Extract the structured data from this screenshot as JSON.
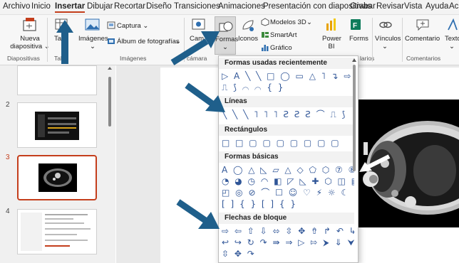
{
  "menu": {
    "tabs": [
      "Archivo",
      "Inicio",
      "Insertar",
      "Dibujar",
      "Recortar",
      "Diseño",
      "Transiciones",
      "Animaciones",
      "Presentación con diapositivas",
      "Grabar",
      "Revisar",
      "Vista",
      "Ayuda",
      "Ac"
    ],
    "active": "Insertar"
  },
  "ribbon": {
    "nueva_line1": "Nueva",
    "nueva_line2": "diapositiva ⌄",
    "tabla": "Ta",
    "imagenes": "Imágenes",
    "captura": "Captura ⌄",
    "album": "Álbum de fotografías",
    "camara": "Cam",
    "formas": "Formas",
    "iconos": "Iconos",
    "modelos3d": "Modelos 3D",
    "smartart": "SmartArt",
    "grafico": "Gráfico",
    "powerbi_line1": "Power",
    "powerbi_line2": "BI",
    "forms": "Forms",
    "vinculos": "Vínculos",
    "comentario": "Comentario",
    "texto": "Texto",
    "groups": {
      "diapositivas": "Diapositivas",
      "tab": "Tab",
      "imagenes": "Imágenes",
      "camara": "cámara",
      "larios": "larios",
      "comentarios": "Comentarios"
    }
  },
  "slides": {
    "numbers": [
      "2",
      "3",
      "4"
    ],
    "selected": "3"
  },
  "shapes_menu": {
    "recent_title": "Formas usadas recientemente",
    "recent_row1": "▷ A ╲ ╲ □ ◯ ▭ △ ˥ ↴ ⇨ ⇩",
    "recent_row2": "⎍ ⟆ ⌒ ⌒ { }",
    "lines_title": "Líneas",
    "lines_row": "╲ ╲ ╲ ˥ ˥ ˥ Ƨ Ƨ Ƨ ⌒ ⎍ ⟆",
    "rect_title": "Rectángulos",
    "rect_row": "□ □ ▢ ▢ ▢ ▢ ▢ ▢ ▢",
    "basic_title": "Formas básicas",
    "basic_row1": "A ◯ △ ◺ ▱ △ ◇ ⬠ ⬡ ⑦ ⑧ ⑩",
    "basic_row2": "◔ ◕ ◷ ◠ ◧ ◸ ◺ ✚ ⬡ ◫ ▤",
    "basic_row3": "◰ ◎ ⊘ ⌒ ☐ ☺ ♡ ⚡ ☼ ☾ ☁ ⌒",
    "basic_row4": "[ ] { } [ ] { }",
    "block_title": "Flechas de bloque",
    "block_row1": "⇨ ⇦ ⇧ ⇩ ⬄ ⇳ ✥ ⇮ ↱ ↶ ↳ ↲",
    "block_row2": "↩ ↪ ↻ ↷ ⇛ ⇒ ▷ ⇰ ⮞ ⇓ ⮟ ⇮",
    "block_row3": "⇳ ✥ ↷"
  },
  "colors": {
    "accent": "#c43e1c",
    "shape_blue": "#2f5597",
    "arrow_blue": "#1f5f8b"
  }
}
